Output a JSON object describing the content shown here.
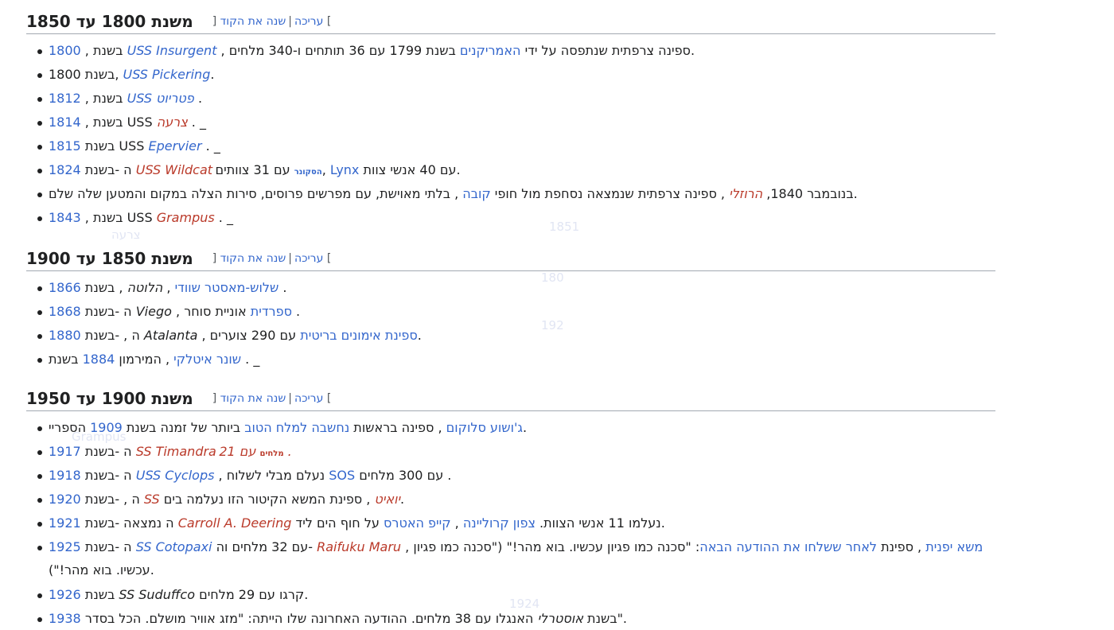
{
  "edit_links": {
    "edit": "עריכה",
    "edit_source": "שנה את הקוד",
    "open": "[",
    "close": "]",
    "sep": "|"
  },
  "sections": [
    {
      "title": "משנת 1800 עד 1850",
      "items": [
        [
          "1800",
          " , בשנת ",
          "USS Insurgent",
          " , ספינה צרפתית שנתפסה על ידי ",
          "האמריקנים",
          " בשנת 1799 עם 36 תותחים ו-340 מלחים."
        ],
        [
          "USS Pickering",
          " בשנת 1800, ",
          "."
        ],
        [
          "1812",
          " , בשנת ",
          "USS פטריוט",
          " ."
        ],
        [
          "1814",
          " , בשנת USS ",
          "צרעה",
          " . _"
        ],
        [
          "1815",
          " בשנת USS ",
          "Epervier",
          " . _"
        ],
        [
          "1824",
          " ה -בשנת ",
          "USS Wildcat",
          " הסקונר",
          " עם 31 צוותים, ",
          "Lynx",
          " עם 40 אנשי צוות."
        ],
        [
          "בנובמבר 1840, ",
          "הרוזלי",
          " , ספינה צרפתית שנמצאה נסחפת מול חופי ",
          "קובה",
          " , בלתי מאוישת, עם מפרשים פרוסים, סירות הצלה במקום והמטען שלה שלם."
        ],
        [
          "1843",
          " , בשנת USS ",
          "Grampus",
          " . _"
        ]
      ]
    },
    {
      "title": "משנת 1850 עד 1900",
      "items": [
        [
          "שלוש-מאסטר שוודי",
          " , ",
          "הלוטה",
          " , בשנת ",
          "1866",
          " ."
        ],
        [
          "1868",
          " ה -בשנת ",
          "Viego",
          " , ",
          "ספרדית",
          " אוניית סוחר ."
        ],
        [
          "1880",
          " ה , -בשנת ",
          "Atalanta",
          " , ",
          "ספינת אימונים בריטית",
          " עם 290 צוערים."
        ],
        [
          "שונר איטלקי",
          " , המירמון ",
          "1884",
          " בשנת . _"
        ]
      ]
    },
    {
      "title": "משנת 1900 עד 1950",
      "items": [
        [
          "ג'ושוע סלוקום",
          " , ספינה בראשות ",
          "נחשבה למלח הטוב",
          " ביותר של זמנה בשנת ",
          "1909",
          " הספריי."
        ],
        [
          "1917",
          " ה -בשנת ",
          "SS Timandra",
          " מלחים",
          " עם 21 ."
        ],
        [
          "1918",
          " ה -בשנת ",
          "USS Cyclops",
          " , נעלם מבלי לשלוח ",
          "SOS",
          " עם 300 מלחים ."
        ],
        [
          "1920",
          " ה , -בשנת ",
          "SS",
          " ",
          "יואיט",
          " , ספינת המשא הקיטור הזו נעלמה בים."
        ],
        [
          "1921",
          " ה נמצאה -בשנת ",
          "Carroll A. Deering",
          " נעלמו 11 אנשי הצוות. ",
          "צפון קרוליינה",
          " , ",
          "קייפ האטרס",
          " על חוף הים ליד."
        ],
        [
          "1925",
          " ה -בשנת ",
          "SS Cotopaxi",
          " עם 32 מלחים וה- ",
          "Raifuku Maru",
          " , ",
          "משא יפנית",
          " , ספינת ",
          "לאחר ששלחו את ההודעה הבאה",
          ": \"סכנה כמו פגיון עכשיו. בוא מהר!\" (\"סכנה כמו פגיון עכשיו. בוא מהר!\")."
        ],
        [
          "1926",
          " בשנת ",
          "SS Suduffco",
          " קרגו עם 29 מלחים."
        ],
        [
          "1938",
          " בשנת ",
          "אוסטרלי",
          " האנגלו עם 38 מלחים. ההודעה האחרונה שלו הייתה: \"מזג אוויר מושלם. הכל בסדר\"."
        ]
      ]
    }
  ],
  "ghost_text": [
    "צרעה",
    "1851",
    "192",
    "Grampus",
    "1924",
    "180"
  ]
}
